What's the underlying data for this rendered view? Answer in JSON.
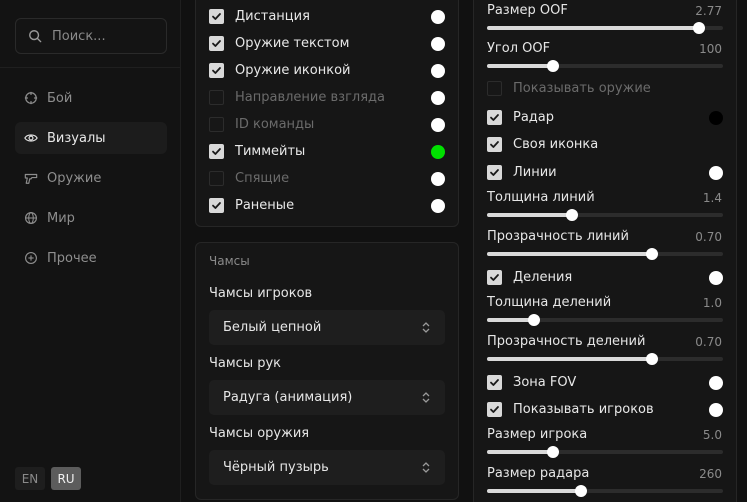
{
  "sidebar": {
    "search_placeholder": "Поиск...",
    "items": [
      {
        "label": "Бой",
        "icon": "crosshair-icon",
        "active": false
      },
      {
        "label": "Визуалы",
        "icon": "eye-icon",
        "active": true
      },
      {
        "label": "Оружие",
        "icon": "gun-icon",
        "active": false
      },
      {
        "label": "Мир",
        "icon": "globe-icon",
        "active": false
      },
      {
        "label": "Прочее",
        "icon": "plus-circle-icon",
        "active": false
      }
    ],
    "languages": [
      "EN",
      "RU"
    ],
    "active_language": "RU"
  },
  "esp_panel": {
    "rows": [
      {
        "label": "Дистанция",
        "checked": true,
        "color": "#ffffff"
      },
      {
        "label": "Оружие текстом",
        "checked": true,
        "color": "#ffffff"
      },
      {
        "label": "Оружие иконкой",
        "checked": true,
        "color": "#ffffff"
      },
      {
        "label": "Направление взгляда",
        "checked": false,
        "color": "#ffffff"
      },
      {
        "label": "ID команды",
        "checked": false,
        "color": "#ffffff"
      },
      {
        "label": "Тиммейты",
        "checked": true,
        "color": "#00e000"
      },
      {
        "label": "Спящие",
        "checked": false,
        "color": "#ffffff"
      },
      {
        "label": "Раненые",
        "checked": true,
        "color": "#ffffff"
      }
    ]
  },
  "chams_panel": {
    "title": "Чамсы",
    "fields": [
      {
        "label": "Чамсы игроков",
        "value": "Белый цепной"
      },
      {
        "label": "Чамсы рук",
        "value": "Радуга (анимация)"
      },
      {
        "label": "Чамсы оружия",
        "value": "Чёрный пузырь"
      }
    ]
  },
  "radar_panel": {
    "sliders": {
      "oof_size": {
        "label": "Размер OOF",
        "value": "2.77",
        "fraction": 0.9
      },
      "oof_angle": {
        "label": "Угол OOF",
        "value": "100",
        "fraction": 0.28
      },
      "line_width": {
        "label": "Толщина линий",
        "value": "1.4",
        "fraction": 0.36
      },
      "line_opacity": {
        "label": "Прозрачность линий",
        "value": "0.70",
        "fraction": 0.7
      },
      "div_width": {
        "label": "Толщина делений",
        "value": "1.0",
        "fraction": 0.2
      },
      "div_opacity": {
        "label": "Прозрачность делений",
        "value": "0.70",
        "fraction": 0.7
      },
      "player_size": {
        "label": "Размер игрока",
        "value": "5.0",
        "fraction": 0.28
      },
      "radar_size": {
        "label": "Размер радара",
        "value": "260",
        "fraction": 0.4
      }
    },
    "toggles": {
      "show_weapon": {
        "label": "Показывать оружие",
        "checked": false
      },
      "radar": {
        "label": "Радар",
        "checked": true,
        "color": "#000000"
      },
      "own_icon": {
        "label": "Своя иконка",
        "checked": true
      },
      "lines": {
        "label": "Линии",
        "checked": true,
        "color": "#ffffff"
      },
      "divisions": {
        "label": "Деления",
        "checked": true,
        "color": "#ffffff"
      },
      "fov_zone": {
        "label": "Зона FOV",
        "checked": true,
        "color": "#ffffff"
      },
      "show_players": {
        "label": "Показывать игроков",
        "checked": true,
        "color": "#ffffff"
      }
    }
  },
  "colors": {
    "accent": "#d9d9d9",
    "teammate": "#00e000"
  }
}
